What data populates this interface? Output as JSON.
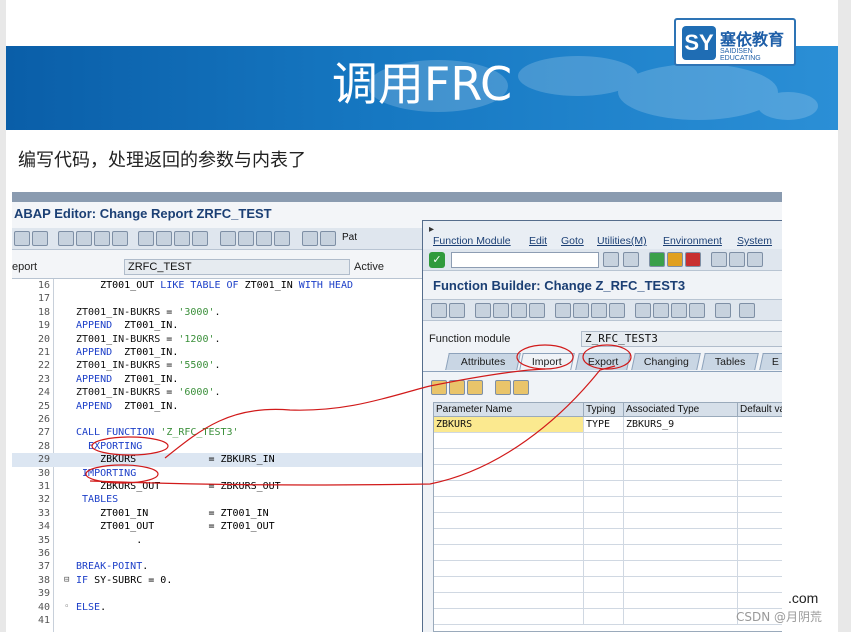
{
  "slide": {
    "title": "调用FRC",
    "subtitle": "编写代码，处理返回的参数与内表了",
    "logo_cn": "塞依教育",
    "logo_en": "SAIDISEN EDUCATING",
    "logo_mark": "SY",
    "footer_com": ".com",
    "footer_csdn": "CSDN @月阴荒"
  },
  "editor": {
    "title": "ABAP Editor: Change Report ZRFC_TEST",
    "program_label": "eport",
    "program_name": "ZRFC_TEST",
    "status": "Active",
    "toolbar_pat": "Pat",
    "lines": [
      {
        "n": "16",
        "text": "    ZT001_OUT LIKE TABLE OF ZT001_IN WITH HEAD"
      },
      {
        "n": "17",
        "text": ""
      },
      {
        "n": "18",
        "text": "ZT001_IN-BUKRS = '3000'."
      },
      {
        "n": "19",
        "text": "APPEND  ZT001_IN."
      },
      {
        "n": "20",
        "text": "ZT001_IN-BUKRS = '1200'."
      },
      {
        "n": "21",
        "text": "APPEND  ZT001_IN."
      },
      {
        "n": "22",
        "text": "ZT001_IN-BUKRS = '5500'."
      },
      {
        "n": "23",
        "text": "APPEND  ZT001_IN."
      },
      {
        "n": "24",
        "text": "ZT001_IN-BUKRS = '6000'."
      },
      {
        "n": "25",
        "text": "APPEND  ZT001_IN."
      },
      {
        "n": "26",
        "text": ""
      },
      {
        "n": "27",
        "text": "CALL FUNCTION 'Z_RFC_TEST3'"
      },
      {
        "n": "28",
        "text": "  EXPORTING"
      },
      {
        "n": "29",
        "text": "    ZBKURS            = ZBKURS_IN"
      },
      {
        "n": "30",
        "text": " IMPORTING"
      },
      {
        "n": "31",
        "text": "    ZBKURS_OUT        = ZBKURS_OUT"
      },
      {
        "n": "32",
        "text": " TABLES"
      },
      {
        "n": "33",
        "text": "    ZT001_IN          = ZT001_IN"
      },
      {
        "n": "34",
        "text": "    ZT001_OUT         = ZT001_OUT"
      },
      {
        "n": "35",
        "text": "          ."
      },
      {
        "n": "36",
        "text": ""
      },
      {
        "n": "37",
        "text": "BREAK-POINT."
      },
      {
        "n": "38",
        "text": "IF SY-SUBRC = 0."
      },
      {
        "n": "39",
        "text": ""
      },
      {
        "n": "40",
        "text": "ELSE."
      },
      {
        "n": "41",
        "text": ""
      }
    ]
  },
  "function_builder": {
    "menu": [
      "Function Module",
      "Edit",
      "Goto",
      "Utilities(M)",
      "Environment",
      "System"
    ],
    "title": "Function Builder: Change Z_RFC_TEST3",
    "fm_label": "Function module",
    "fm_value": "Z_RFC_TEST3",
    "tabs": [
      "Attributes",
      "Import",
      "Export",
      "Changing",
      "Tables",
      "E"
    ],
    "active_tab": "Import",
    "grid_headers": [
      "Parameter Name",
      "Typing",
      "Associated Type",
      "Default va"
    ],
    "grid_row": [
      "ZBKURS",
      "TYPE",
      "ZBKURS_9",
      ""
    ]
  },
  "colors": {
    "banner": "#1678c2",
    "sap_title": "#1b3f74",
    "keyword": "#1c3fc8",
    "string": "#3a8f3a",
    "ink": "#d11a1a"
  }
}
